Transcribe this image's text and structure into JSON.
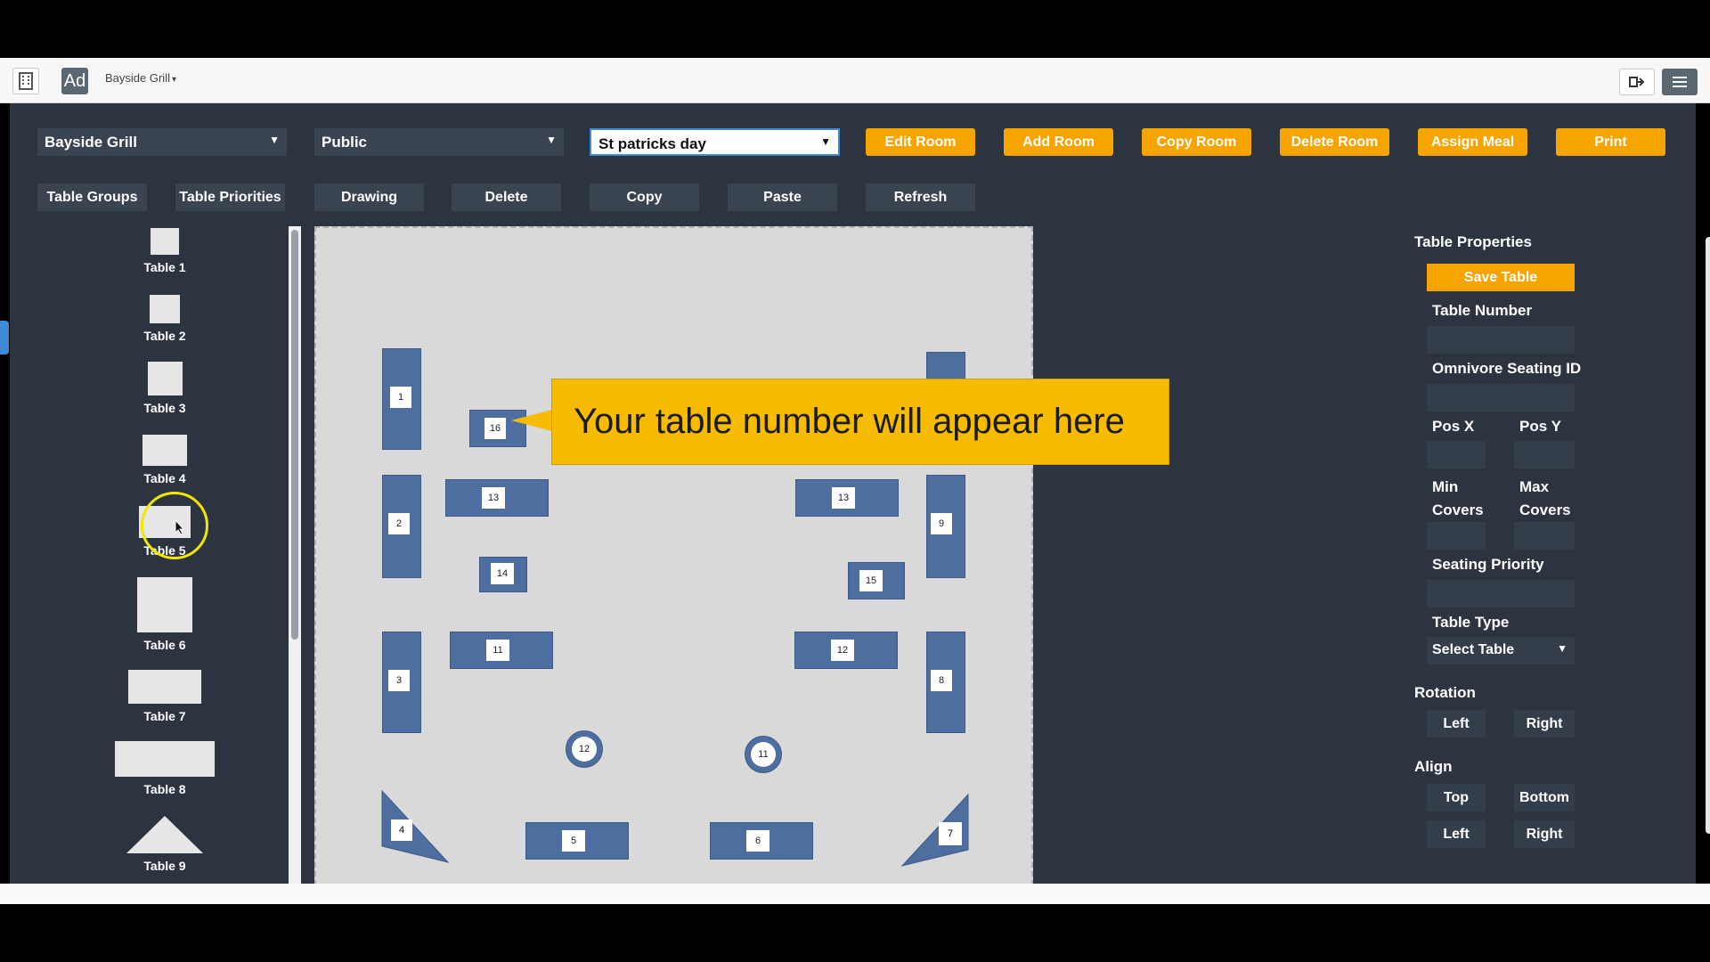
{
  "topbar": {
    "venue": "Bayside Grill",
    "logo_text": "Ad"
  },
  "controls": {
    "venue_select": "Bayside Grill",
    "visibility_select": "Public",
    "room_select": "St patricks day",
    "edit_room": "Edit Room",
    "add_room": "Add Room",
    "copy_room": "Copy Room",
    "delete_room": "Delete Room",
    "assign_meal": "Assign Meal",
    "print": "Print",
    "table_groups": "Table Groups",
    "table_priorities": "Table Priorities",
    "drawing": "Drawing",
    "delete": "Delete",
    "copy": "Copy",
    "paste": "Paste",
    "refresh": "Refresh"
  },
  "palette": [
    {
      "label": "Table 1"
    },
    {
      "label": "Table 2"
    },
    {
      "label": "Table 3"
    },
    {
      "label": "Table 4"
    },
    {
      "label": "Table 5"
    },
    {
      "label": "Table 6"
    },
    {
      "label": "Table 7"
    },
    {
      "label": "Table 8"
    },
    {
      "label": "Table 9"
    }
  ],
  "tables": [
    "1",
    "16",
    "13",
    "13",
    "9",
    "2",
    "14",
    "15",
    "3",
    "11",
    "12",
    "8",
    "12",
    "11",
    "4",
    "5",
    "6",
    "7"
  ],
  "tooltip": "Your table number will appear here",
  "properties": {
    "title": "Table Properties",
    "save": "Save Table",
    "table_number": "Table Number",
    "omnivore": "Omnivore Seating ID",
    "pos_x": "Pos X",
    "pos_y": "Pos Y",
    "min_covers_1": "Min",
    "min_covers_2": "Covers",
    "max_covers_1": "Max",
    "max_covers_2": "Covers",
    "seating_priority": "Seating Priority",
    "table_type": "Table Type",
    "table_type_value": "Select Table",
    "rotation": "Rotation",
    "rot_left": "Left",
    "rot_right": "Right",
    "align": "Align",
    "align_top": "Top",
    "align_bottom": "Bottom",
    "align_left": "Left",
    "align_right": "Right"
  },
  "colors": {
    "panel": "#2c3440",
    "accent": "#f7a400",
    "table": "#4d6e9e",
    "tooltip": "#f7bc00"
  }
}
